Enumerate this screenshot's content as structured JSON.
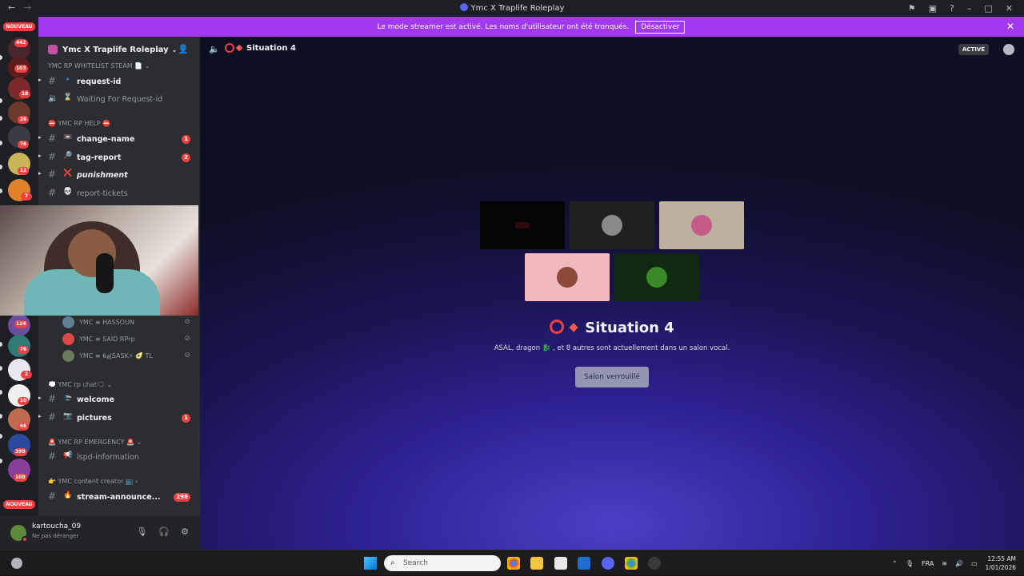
{
  "window": {
    "title": "Ymc X Traplife Roleplay",
    "icons": [
      "inbox-icon",
      "window-icon",
      "help-icon",
      "minimize-icon",
      "maximize-icon",
      "close-icon"
    ]
  },
  "banner": {
    "text": "Le mode streamer est activé. Les noms d'utilisateur ont été tronqués.",
    "button": "Désactiver"
  },
  "guilds": {
    "nouveau_top": "NOUVEAU",
    "nouveau_bottom": "NOUVEAU",
    "badges": [
      "442",
      "103",
      "18",
      "26",
      "76",
      "12",
      "7",
      "124",
      "76",
      "2",
      "10",
      "66",
      "399",
      "108"
    ]
  },
  "server": {
    "name": "Ymc X Traplife Roleplay"
  },
  "sidebar": {
    "categories": {
      "whitelist": "YMC RP WHITELIST STEAM 📄",
      "help": "⛔ YMC RP HELP ⛔",
      "chat": "💭 YMC rp chat🗨",
      "emergency": "🚨 YMC RP EMERGENCY 🚨",
      "creator": "👉 YMC content creator 📺"
    },
    "channels": [
      {
        "name": "request-id",
        "emoji": "🔹"
      },
      {
        "name": "Waiting For Request-id",
        "emoji": "⌛"
      },
      {
        "name": "change-name",
        "emoji": "📼",
        "badge": "1"
      },
      {
        "name": "tag-report",
        "emoji": "🔎",
        "badge": "2"
      },
      {
        "name": "punishment",
        "emoji": "❌"
      },
      {
        "name": "report-tickets",
        "emoji": "💀"
      },
      {
        "name": "welcome",
        "emoji": "🛬"
      },
      {
        "name": "pictures",
        "emoji": "📷",
        "badge": "1"
      },
      {
        "name": "lspd-information",
        "emoji": "📢"
      },
      {
        "name": "stream-announce...",
        "emoji": "🔥",
        "badge": "298"
      }
    ],
    "voice_users": [
      {
        "name": "YMC ≡ HASSOUN"
      },
      {
        "name": "YMC ≡ SAID RPrp"
      },
      {
        "name": "YMC ≡ 𝕮𝖌|SASK⚡ 🥑 TL"
      }
    ]
  },
  "user": {
    "name": "kartoucha_09",
    "status": "Ne pas déranger"
  },
  "main": {
    "header_title": "Situation 4",
    "active_label": "ACTIVÉ",
    "big_title": "Situation 4",
    "subtitle": "ASAL, dragon 🐉 , et 8 autres sont actuellement dans un salon vocal.",
    "locked_button": "Salon verrouillé"
  },
  "taskbar": {
    "search_placeholder": "Search",
    "language": "FRA",
    "time": "12:55 AM",
    "date": "1/01/2026"
  },
  "colors": {
    "accent": "#5865f2",
    "banner": "#a139f0",
    "danger": "#f23f42",
    "sidebar": "#2b2d31",
    "guild_rail": "#1e1f22"
  }
}
